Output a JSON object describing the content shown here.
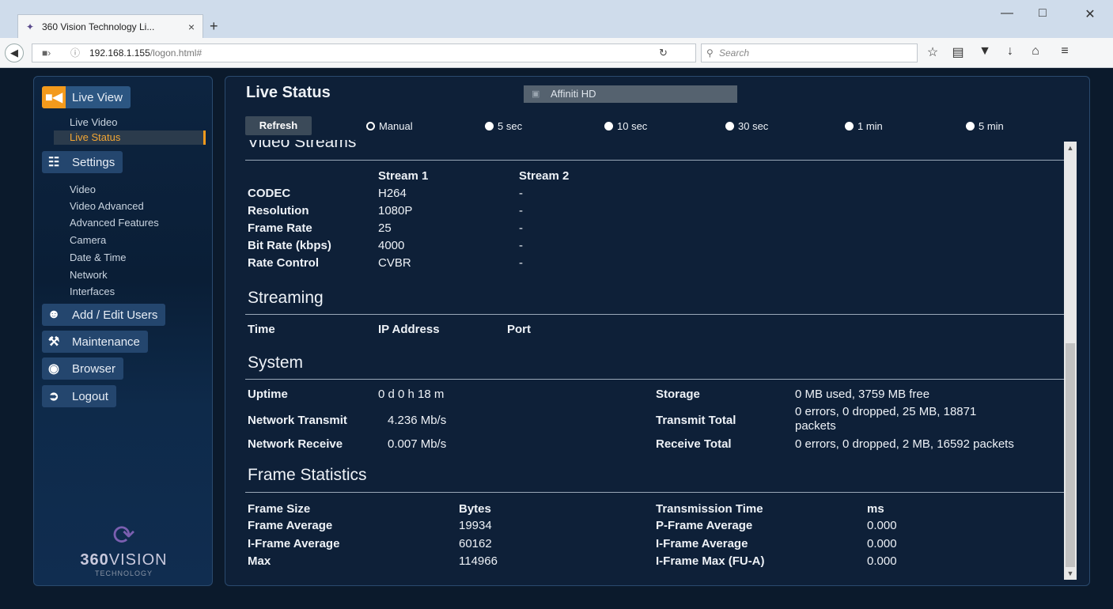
{
  "browser": {
    "tab_title": "360 Vision Technology Li...",
    "tab_close": "×",
    "new_tab": "+",
    "url_host": "192.168.1.155",
    "url_path": "/logon.html#",
    "search_placeholder": "Search"
  },
  "sidebar": {
    "live_view": "Live View",
    "live_video": "Live Video",
    "live_status": "Live Status",
    "settings": "Settings",
    "settings_items": [
      "Video",
      "Video Advanced",
      "Advanced Features",
      "Camera",
      "Date & Time",
      "Network",
      "Interfaces"
    ],
    "add_edit_users": "Add / Edit Users",
    "maintenance": "Maintenance",
    "browser": "Browser",
    "logout": "Logout",
    "logo_brand_bold": "360",
    "logo_brand_rest": "VISION",
    "logo_sub": "TECHNOLOGY"
  },
  "panel": {
    "title": "Live Status",
    "camera": "Affiniti HD",
    "refresh": "Refresh",
    "radios": [
      "Manual",
      "5 sec",
      "10 sec",
      "30 sec",
      "1 min",
      "5 min"
    ]
  },
  "video_streams": {
    "heading": "Video Streams",
    "col1": "Stream 1",
    "col2": "Stream 2",
    "rows": [
      {
        "label": "CODEC",
        "s1": "H264",
        "s2": "-"
      },
      {
        "label": "Resolution",
        "s1": "1080P",
        "s2": "-"
      },
      {
        "label": "Frame Rate",
        "s1": "25",
        "s2": "-"
      },
      {
        "label": "Bit Rate (kbps)",
        "s1": "4000",
        "s2": "-"
      },
      {
        "label": "Rate Control",
        "s1": "CVBR",
        "s2": "-"
      }
    ]
  },
  "streaming": {
    "heading": "Streaming",
    "cols": [
      "Time",
      "IP Address",
      "Port"
    ]
  },
  "system": {
    "heading": "System",
    "uptime_label": "Uptime",
    "uptime": "0 d 0 h 18 m",
    "net_tx_label": "Network Transmit",
    "net_tx": "4.236 Mb/s",
    "net_rx_label": "Network Receive",
    "net_rx": "0.007 Mb/s",
    "storage_label": "Storage",
    "storage": "0 MB used, 3759 MB free",
    "tx_total_label": "Transmit Total",
    "tx_total_1": "0 errors, 0 dropped, 25 MB, 18871",
    "tx_total_2": "packets",
    "rx_total_label": "Receive Total",
    "rx_total": "0 errors, 0 dropped, 2 MB, 16592 packets"
  },
  "frame_stats": {
    "heading": "Frame Statistics",
    "left": [
      {
        "label": "Frame Size",
        "value": "Bytes"
      },
      {
        "label": "Frame Average",
        "value": "19934"
      },
      {
        "label": "I-Frame Average",
        "value": "60162"
      },
      {
        "label": "Max",
        "value": "114966"
      }
    ],
    "right": [
      {
        "label": "Transmission Time",
        "value": "ms"
      },
      {
        "label": "P-Frame Average",
        "value": "0.000"
      },
      {
        "label": "I-Frame Average",
        "value": "0.000"
      },
      {
        "label": "I-Frame Max (FU-A)",
        "value": "0.000"
      }
    ]
  },
  "colors": {
    "accent": "#f39a1c",
    "background": "#0b1a2c",
    "panel": "#0e2038"
  }
}
